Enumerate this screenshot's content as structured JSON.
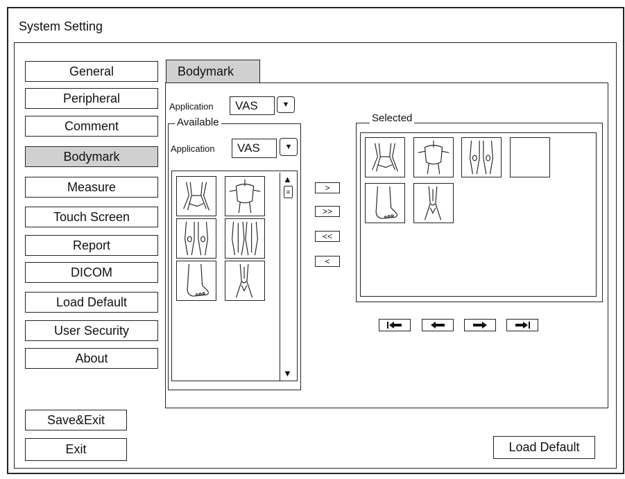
{
  "window": {
    "title": "System Setting"
  },
  "sidebar": {
    "items": [
      {
        "label": "General"
      },
      {
        "label": "Peripheral"
      },
      {
        "label": "Comment"
      },
      {
        "label": "Bodymark",
        "active": true
      },
      {
        "label": "Measure"
      },
      {
        "label": "Touch Screen"
      },
      {
        "label": "Report"
      },
      {
        "label": "DICOM"
      },
      {
        "label": "Load Default"
      },
      {
        "label": "User Security"
      },
      {
        "label": "About"
      }
    ]
  },
  "tab": {
    "label": "Bodymark"
  },
  "application": {
    "label": "Application",
    "value": "VAS"
  },
  "available": {
    "group_label": "Available",
    "application_label": "Application",
    "application_value": "VAS",
    "thumbnails": [
      "vessels-icon",
      "torso-icon",
      "legs-front-icon",
      "legs-back-icon",
      "foot-icon",
      "leg-vein-icon"
    ]
  },
  "transfer": {
    "add": ">",
    "add_all": ">>",
    "remove_all": "<<",
    "remove": "<"
  },
  "selected": {
    "group_label": "Selected",
    "thumbnails": [
      "vessels-icon",
      "torso-icon",
      "legs-front-icon",
      "empty",
      "foot-icon",
      "leg-vein-icon"
    ]
  },
  "order_nav": [
    "move-first-icon",
    "move-left-icon",
    "move-right-icon",
    "move-last-icon"
  ],
  "footer": {
    "save_exit": "Save&Exit",
    "exit": "Exit",
    "load_default": "Load Default"
  }
}
